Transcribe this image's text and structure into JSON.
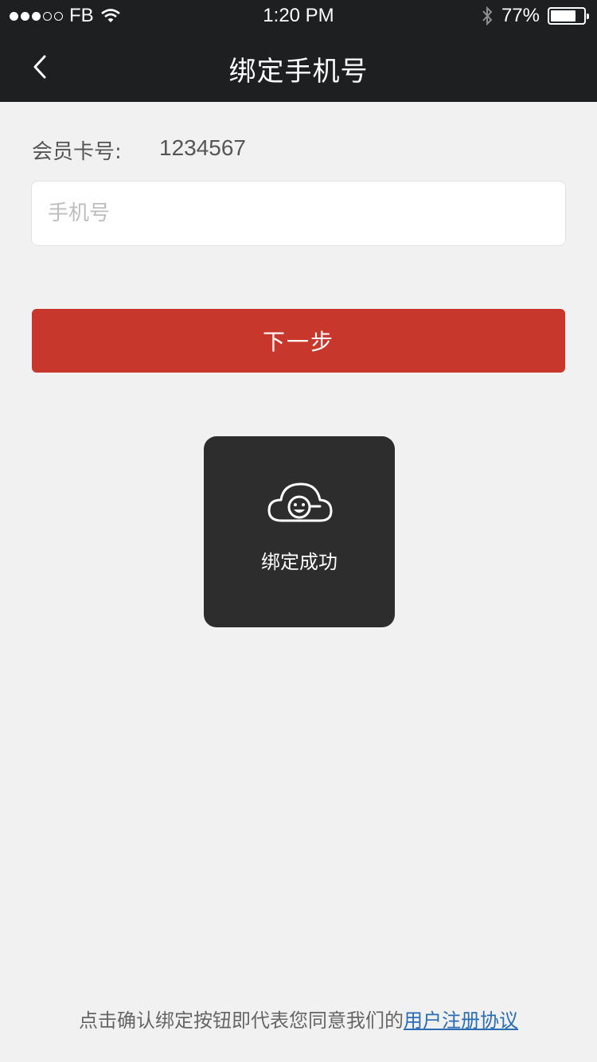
{
  "status_bar": {
    "carrier": "FB",
    "time": "1:20 PM",
    "battery": "77%",
    "signal_icon": "signal-dots-icon",
    "wifi_icon": "wifi-icon",
    "bluetooth_icon": "bluetooth-icon",
    "battery_level": 0.77
  },
  "header": {
    "title": "绑定手机号",
    "back_icon": "chevron-left-icon"
  },
  "card": {
    "label": "会员卡号:",
    "number": "1234567"
  },
  "form": {
    "phone_placeholder": "手机号",
    "phone_value": "",
    "next_label": "下一步"
  },
  "toast": {
    "icon": "smiling-cloud-icon",
    "message": "绑定成功"
  },
  "footer": {
    "text": "点击确认绑定按钮即代表您同意我们的",
    "link": "用户注册协议"
  },
  "colors": {
    "header_bg": "#1e1f21",
    "page_bg": "#f1f1f1",
    "primary_button": "#c8372b",
    "toast_bg": "#2d2d2d",
    "link": "#2a6db4"
  }
}
